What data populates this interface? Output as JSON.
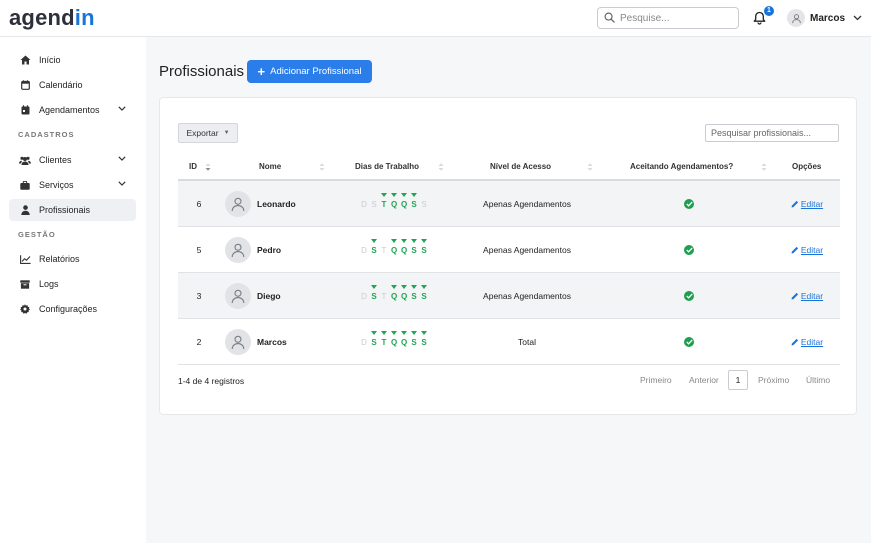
{
  "app": {
    "logo_main": "agend",
    "logo_accent": "in"
  },
  "header": {
    "search_placeholder": "Pesquise...",
    "notification_count": "1",
    "user_name": "Marcos"
  },
  "sidebar": {
    "items": [
      {
        "label": "Início",
        "icon": "home-icon"
      },
      {
        "label": "Calendário",
        "icon": "calendar-icon"
      },
      {
        "label": "Agendamentos",
        "icon": "appointments-icon"
      },
      {
        "label": "Clientes",
        "icon": "users-icon"
      },
      {
        "label": "Serviços",
        "icon": "briefcase-icon"
      },
      {
        "label": "Profissionais",
        "icon": "user-icon"
      },
      {
        "label": "Relatórios",
        "icon": "chart-icon"
      },
      {
        "label": "Logs",
        "icon": "logs-icon"
      },
      {
        "label": "Configurações",
        "icon": "gear-icon"
      }
    ],
    "section_cadastros": "CADASTROS",
    "section_gestao": "GESTÃO"
  },
  "page": {
    "title": "Profissionais",
    "add_button": "Adicionar Profissional"
  },
  "table": {
    "export_label": "Exportar",
    "search_placeholder": "Pesquisar profissionais...",
    "columns": {
      "id": "ID",
      "name": "Nome",
      "days": "Dias de Trabalho",
      "access": "Nível de Acesso",
      "accepting": "Aceitando Agendamentos?",
      "options": "Opções"
    },
    "day_letters": [
      "D",
      "S",
      "T",
      "Q",
      "Q",
      "S",
      "S"
    ],
    "edit_label": "Editar",
    "rows": [
      {
        "id": "6",
        "name": "Leonardo",
        "days": [
          0,
          0,
          1,
          1,
          1,
          1,
          0
        ],
        "access": "Apenas Agendamentos",
        "accepting": true
      },
      {
        "id": "5",
        "name": "Pedro",
        "days": [
          0,
          1,
          0,
          1,
          1,
          1,
          1
        ],
        "access": "Apenas Agendamentos",
        "accepting": true
      },
      {
        "id": "3",
        "name": "Diego",
        "days": [
          0,
          1,
          0,
          1,
          1,
          1,
          1
        ],
        "access": "Apenas Agendamentos",
        "accepting": true
      },
      {
        "id": "2",
        "name": "Marcos",
        "days": [
          0,
          1,
          1,
          1,
          1,
          1,
          1
        ],
        "access": "Total",
        "accepting": true
      }
    ],
    "records_text": "1-4 de 4 registros",
    "pagination": {
      "first": "Primeiro",
      "prev": "Anterior",
      "current": "1",
      "next": "Próximo",
      "last": "Último"
    }
  },
  "colors": {
    "accent": "#2b7de9",
    "success": "#1ea653",
    "inactive_day": "#c9cbcf"
  }
}
